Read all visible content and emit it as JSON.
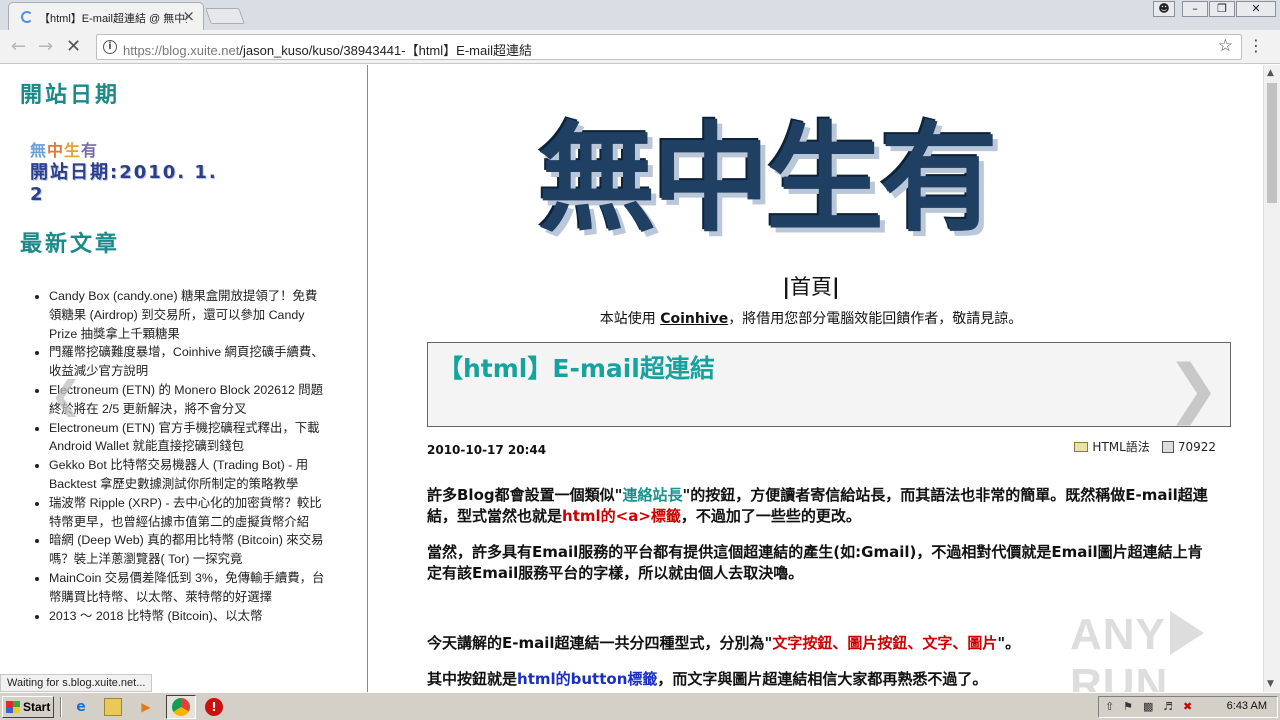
{
  "browser": {
    "tab_title": "【html】E-mail超連結 @ 無中生有 :: 隨意窩 Xuite日誌",
    "tab_close": "×",
    "url_domain": "https://blog.xuite.net",
    "url_path": "/jason_kuso/kuso/38943441-【html】E-mail超連結",
    "status_text": "Waiting for s.blog.xuite.net..."
  },
  "sidebar": {
    "heading_date": "開站日期",
    "badge_line1_parts": [
      "無",
      "中",
      "生",
      "有"
    ],
    "badge_line2": "開站日期:2010. 1. 2",
    "heading_latest": "最新文章",
    "articles": [
      "Candy Box (candy.one) 糖果盒開放提領了！免費領糖果 (Airdrop) 到交易所，還可以參加 Candy Prize 抽獎拿上千顆糖果",
      "門羅幣挖礦難度暴增，Coinhive 網頁挖礦手續費、收益減少官方說明",
      "Electroneum (ETN) 的 Monero Block 202612 問題終於將在 2/5 更新解決，將不會分叉",
      "Electroneum (ETN) 官方手機挖礦程式釋出，下載 Android Wallet 就能直接挖礦到錢包",
      "Gekko Bot 比特幣交易機器人 (Trading Bot) - 用 Backtest 拿歷史數據測試你所制定的策略教學",
      "瑞波幣 Ripple (XRP) - 去中心化的加密貨幣？較比特幣更早，也曾經佔據市值第二的虛擬貨幣介紹",
      "暗網 (Deep Web) 真的都用比特幣 (Bitcoin) 來交易嗎？裝上洋蔥瀏覽器( Tor) 一探究竟",
      "MainCoin 交易價差降低到 3%，免傳輸手續費，台幣購買比特幣、以太幣、萊特幣的好選擇",
      "2013 ～ 2018 比特幣 (Bitcoin)、以太幣"
    ]
  },
  "main": {
    "logo_text": "無中生有",
    "home_sep_left": "|",
    "home_label": "首頁",
    "home_sep_right": "|",
    "notice_prefix": "本站使用 ",
    "notice_link": "Coinhive",
    "notice_suffix": "，將借用您部分電腦效能回饋作者，敬請見諒。",
    "post_title": "【html】E-mail超連結",
    "post_date": "2010-10-17 20:44",
    "post_category": "HTML語法",
    "post_views": "70922",
    "p1_a": "許多Blog都會設置一個類似\"",
    "p1_b": "連絡站長",
    "p1_c": "\"的按鈕，方便讀者寄信給站長，而其語法也非常的簡單。既然稱做E-mail超連結，型式當然也就是",
    "p1_d": "html的<a>標籤",
    "p1_e": "，不過加了一些些的更改。",
    "p2": "當然，許多具有Email服務的平台都有提供這個超連結的產生(如:Gmail)，不過相對代價就是Email圖片超連結上肯定有該Email服務平台的字樣，所以就由個人去取決嚕。",
    "p3_a": "今天講解的E-mail超連結一共分四種型式，分別為\"",
    "p3_b": "文字按鈕、圖片按鈕、文字、圖片",
    "p3_c": "\"。",
    "p4_a": "其中按鈕就是",
    "p4_b": "html的button標籤",
    "p4_c": "，而文字與圖片超連結相信大家都再熟悉不過了。"
  },
  "watermark": {
    "left": "ANY",
    "right": "RUN"
  },
  "taskbar": {
    "start_label": "Start",
    "clock": "6:43 AM"
  },
  "colors": {
    "accent_teal": "#1a8a88",
    "link_red": "#cc0000",
    "link_blue": "#1a2ec8",
    "logo_navy": "#1f3f63"
  },
  "icons": [
    "reload-spinner-icon",
    "back-icon",
    "forward-icon",
    "stop-icon",
    "info-icon",
    "star-icon",
    "menu-icon",
    "folder-icon",
    "views-icon",
    "next-post-icon",
    "ie-icon",
    "explorer-icon",
    "media-icon",
    "chrome-icon",
    "opera-icon"
  ]
}
